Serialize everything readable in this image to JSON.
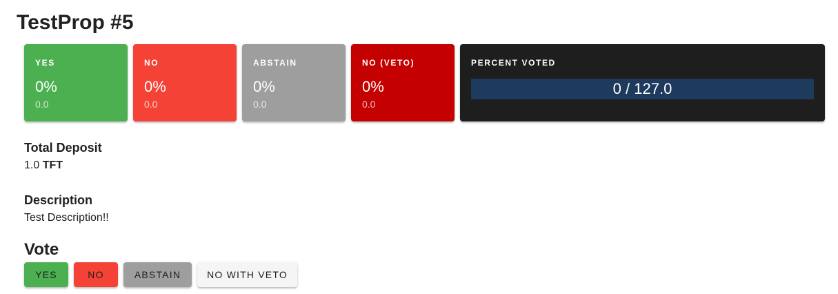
{
  "proposal": {
    "title": "TestProp #5"
  },
  "tally": {
    "yes": {
      "label": "YES",
      "percent": "0%",
      "amount": "0.0",
      "color": "#4caf50"
    },
    "no": {
      "label": "NO",
      "percent": "0%",
      "amount": "0.0",
      "color": "#f44336"
    },
    "abstain": {
      "label": "ABSTAIN",
      "percent": "0%",
      "amount": "0.0",
      "color": "#9e9e9e"
    },
    "veto": {
      "label": "NO (VETO)",
      "percent": "0%",
      "amount": "0.0",
      "color": "#c50000"
    },
    "percent_voted": {
      "label": "PERCENT VOTED",
      "text": "0 / 127.0",
      "voted": 0,
      "total": 127.0,
      "bar_color": "#1e3a5c"
    }
  },
  "deposit": {
    "label": "Total Deposit",
    "amount": "1.0",
    "denom": "TFT"
  },
  "description": {
    "label": "Description",
    "text": "Test Description!!"
  },
  "vote": {
    "title": "Vote",
    "buttons": {
      "yes": "YES",
      "no": "NO",
      "abstain": "ABSTAIN",
      "veto": "NO WITH VETO"
    }
  }
}
